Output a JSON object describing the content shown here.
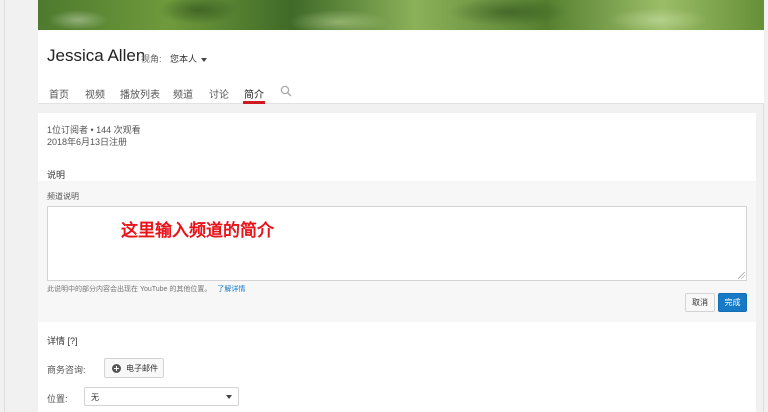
{
  "channel": {
    "name": "Jessica Allen",
    "view_as_label": "视角:",
    "view_as_value": "您本人"
  },
  "tabs": [
    {
      "label": "首页"
    },
    {
      "label": "视频"
    },
    {
      "label": "播放列表"
    },
    {
      "label": "频道"
    },
    {
      "label": "讨论"
    },
    {
      "label": "简介",
      "active": true
    }
  ],
  "about": {
    "stats": "1位订阅者 • 144 次观看",
    "joined": "2018年6月13日注册",
    "description_heading": "说明",
    "description_field_label": "频道说明",
    "description_value": "",
    "annotation": "这里输入频道的简介",
    "hint": "此说明中的部分内容会出现在 YouTube 的其他位置。",
    "hint_link": "了解详情",
    "cancel": "取消",
    "done": "完成",
    "details_heading": "详情 [?]",
    "business_label": "商务咨询:",
    "email_button": "电子邮件",
    "location_label": "位置:",
    "location_value": "无"
  },
  "colors": {
    "accent_red": "#cc181e",
    "primary_blue": "#167ac6",
    "annotation_red": "#e8141a"
  },
  "icons": {
    "search": "search-icon",
    "dropdown": "chevron-down-icon",
    "add": "plus-circle-icon"
  }
}
